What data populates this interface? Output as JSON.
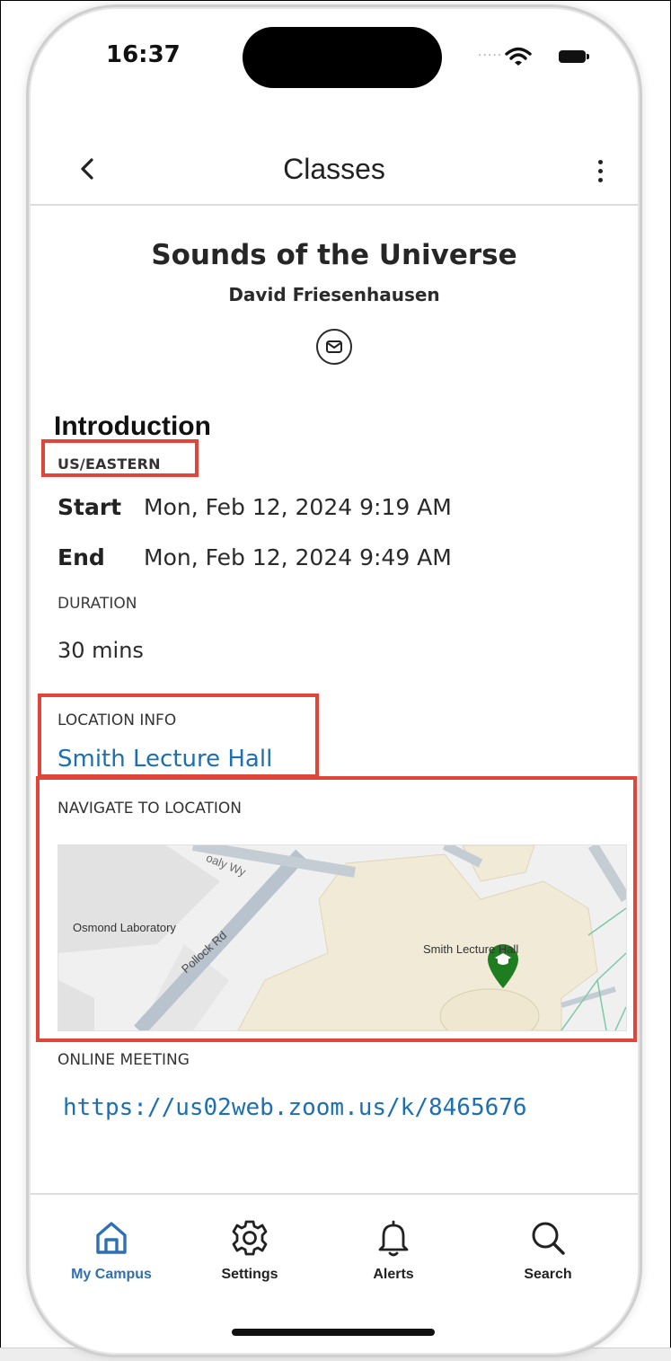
{
  "status_bar": {
    "time": "16:37",
    "signal": "....."
  },
  "header": {
    "title": "Classes"
  },
  "course": {
    "title": "Sounds of the Universe",
    "instructor": "David Friesenhausen"
  },
  "session": {
    "heading": "Introduction",
    "timezone": "US/EASTERN",
    "start_label": "Start",
    "start_value": "Mon, Feb 12, 2024 9:19 AM",
    "end_label": "End",
    "end_value": "Mon, Feb 12, 2024 9:49 AM",
    "duration_label": "DURATION",
    "duration_value": "30 mins"
  },
  "location": {
    "label": "LOCATION INFO",
    "name": "Smith Lecture Hall",
    "navigate_label": "NAVIGATE TO LOCATION",
    "map_labels": {
      "building": "Osmond Laboratory",
      "road": "Pollock Rd",
      "road_top": "oaly Wy",
      "marker": "Smith Lecture Hall"
    }
  },
  "online": {
    "label": "ONLINE MEETING",
    "url": "https://us02web.zoom.us/k/8465676"
  },
  "tabs": [
    {
      "label": "My Campus",
      "icon": "home-icon",
      "active": true
    },
    {
      "label": "Settings",
      "icon": "gear-icon",
      "active": false
    },
    {
      "label": "Alerts",
      "icon": "bell-icon",
      "active": false
    },
    {
      "label": "Search",
      "icon": "search-icon",
      "active": false
    }
  ],
  "colors": {
    "accent": "#2f6fb3",
    "link": "#1c6fb3",
    "highlight": "#e0453a",
    "map_pin": "#1e7d1e"
  }
}
